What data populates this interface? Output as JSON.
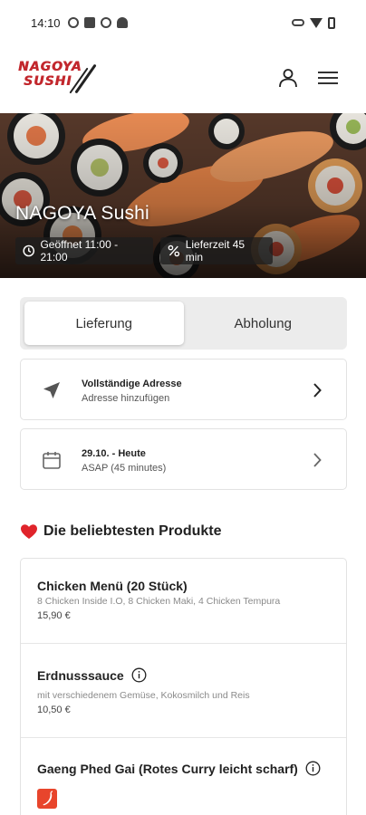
{
  "status_bar": {
    "time": "14:10"
  },
  "header": {
    "logo_line1": "NAGOYA",
    "logo_line2": "SUSHI"
  },
  "hero": {
    "title": "NAGOYA Sushi",
    "opening_hours": "Geöffnet 11:00 - 21:00",
    "delivery_time": "Lieferzeit 45 min"
  },
  "mode_tabs": [
    {
      "label": "Lieferung",
      "active": true
    },
    {
      "label": "Abholung",
      "active": false
    }
  ],
  "address": {
    "title": "Vollständige Adresse",
    "subtitle": "Adresse hinzufügen"
  },
  "schedule": {
    "title": "29.10. - Heute",
    "subtitle": "ASAP (45 minutes)"
  },
  "popular": {
    "title": "Die beliebtesten Produkte",
    "items": [
      {
        "name": "Chicken Menü (20 Stück)",
        "description": "8 Chicken Inside I.O, 8 Chicken Maki, 4 Chicken Tempura",
        "price": "15,90 €"
      },
      {
        "name": "Erdnusssauce",
        "description": "mit verschiedenem Gemüse, Kokosmilch und Reis",
        "price": "10,50 €"
      },
      {
        "name": "Gaeng Phed Gai (Rotes Curry leicht scharf)"
      }
    ]
  },
  "colors": {
    "brand_red": "#c2272d",
    "spicy_badge": "#e8452c",
    "heart": "#e0242b"
  }
}
